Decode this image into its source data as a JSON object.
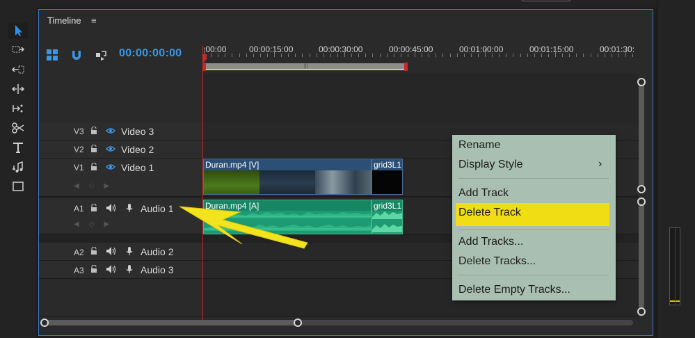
{
  "panel": {
    "title": "Timeline",
    "menu_glyph": "≡",
    "timecode": "00:00:00:00"
  },
  "ruler": {
    "labels": [
      ":00:00",
      "00:00:15:00",
      "00:00:30:00",
      "00:00:45:00",
      "00:01:00:00",
      "00:01:15:00",
      "00:01:30:"
    ]
  },
  "tracks": {
    "video": [
      {
        "id": "V3",
        "name": "Video 3"
      },
      {
        "id": "V2",
        "name": "Video 2"
      },
      {
        "id": "V1",
        "name": "Video 1"
      }
    ],
    "audio": [
      {
        "id": "A1",
        "name": "Audio 1"
      },
      {
        "id": "A2",
        "name": "Audio 2"
      },
      {
        "id": "A3",
        "name": "Audio 3"
      }
    ]
  },
  "clips": {
    "v1_main": "Duran.mp4 [V]",
    "v1_graphic": "grid3L1",
    "a1_main": "Duran.mp4 [A]",
    "a1_graphic": "grid3L1"
  },
  "context_menu": {
    "items": [
      "Rename",
      "Display Style",
      "Add Track",
      "Delete Track",
      "Add Tracks...",
      "Delete Tracks...",
      "Delete Empty Tracks..."
    ],
    "highlighted": "Delete Track",
    "submenu_glyph": "›"
  },
  "colors": {
    "accent_blue": "#3a96e6",
    "playhead_red": "#c9282c",
    "audio_clip_green": "#1e9a72",
    "menu_bg": "#a9bfb1",
    "highlight_yellow": "#f1dd14",
    "annotation_arrow": "#f2e41c"
  },
  "icons": [
    "selection-tool-icon",
    "track-select-icon",
    "ripple-edit-icon",
    "rolling-edit-icon",
    "rate-stretch-icon",
    "razor-icon",
    "type-tool-icon",
    "pen-tool-icon",
    "rectangle-tool-icon",
    "snap-icon",
    "linked-selection-icon",
    "markers-icon",
    "lock-icon",
    "eye-icon",
    "speaker-icon",
    "mic-icon"
  ]
}
